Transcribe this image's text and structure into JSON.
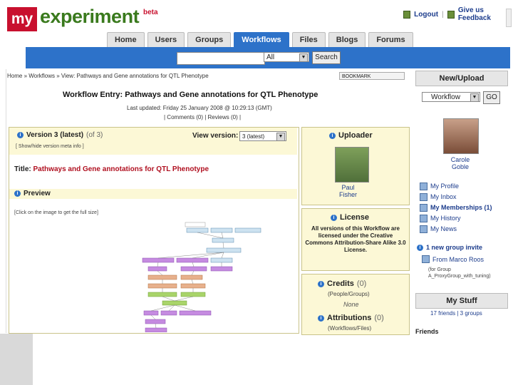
{
  "header": {
    "logo_my": "my",
    "logo_experiment": "experiment",
    "logo_beta": "beta",
    "logout": "Logout",
    "give_feedback": "Give us Feedback"
  },
  "nav": {
    "tabs": [
      "Home",
      "Users",
      "Groups",
      "Workflows",
      "Files",
      "Blogs",
      "Forums"
    ],
    "active": "Workflows"
  },
  "search": {
    "value": "",
    "scope": "All",
    "button": "Search"
  },
  "breadcrumb": "Home » Workflows » View: Pathways and Gene annotations for QTL Phenotype",
  "bookmark": "BOOKMARK",
  "workflow": {
    "title": "Workflow Entry: Pathways and Gene annotations for QTL Phenotype",
    "updated": "Last updated: Friday 25 January 2008 @ 10:29:13 (GMT)",
    "links": "| Comments (0) | Reviews (0) |",
    "version_label": "Version 3 (latest)",
    "version_of": "(of 3)",
    "view_version_label": "View version:",
    "view_version_value": "3 (latest)",
    "show_meta": "[ Show/hide version meta info ]",
    "title_key": "Title:",
    "title_value": "Pathways and Gene annotations for QTL Phenotype",
    "preview_label": "Preview",
    "preview_note": "[Click on the image to get the full size]"
  },
  "uploader": {
    "heading": "Uploader",
    "name_first": "Paul",
    "name_last": "Fisher"
  },
  "license": {
    "heading": "License",
    "text": "All versions of this Workflow are licensed under the Creative Commons Attribution-Share Alike 3.0 License."
  },
  "credits": {
    "heading": "Credits",
    "count": "(0)",
    "sub": "(People/Groups)",
    "none": "None"
  },
  "attributions": {
    "heading": "Attributions",
    "count": "(0)",
    "sub": "(Workflows/Files)"
  },
  "sidebar": {
    "new_upload": "New/Upload",
    "new_select": "Workflow",
    "go": "GO",
    "user_first": "Carole",
    "user_last": "Goble",
    "links": [
      "My Profile",
      "My Inbox",
      "My Memberships (1)",
      "My History",
      "My News"
    ],
    "invite": "1 new group invite",
    "invite_from": "From Marco Roos",
    "invite_group": "(for Group A_ProxyGroup_with_tuning)",
    "my_stuff": "My Stuff",
    "stuff_sub": "17 friends | 3 groups",
    "friends": "Friends"
  },
  "colors": {
    "nav_blue": "#2d72c9",
    "logo_red": "#c8102e",
    "logo_green": "#3a7a1d",
    "panel_yellow": "#fcf8d6",
    "link_blue": "#1c3c8c"
  }
}
